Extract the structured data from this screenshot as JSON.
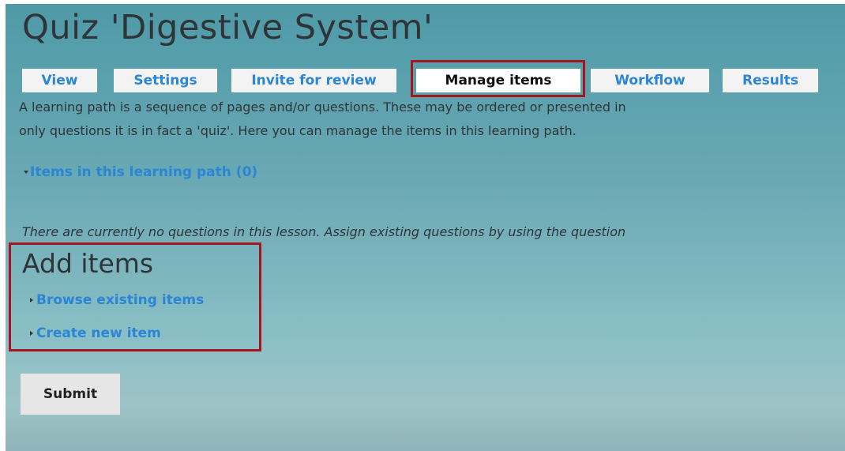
{
  "page": {
    "title": "Quiz 'Digestive System'"
  },
  "tabs": [
    {
      "label": "View",
      "active": false
    },
    {
      "label": "Settings",
      "active": false
    },
    {
      "label": "Invite for review",
      "active": false
    },
    {
      "label": "Manage items",
      "active": true
    },
    {
      "label": "Workflow",
      "active": false
    },
    {
      "label": "Results",
      "active": false
    }
  ],
  "description": {
    "line1": "A learning path is a sequence of pages and/or questions. These may be ordered or presented in",
    "line2": "only questions it is in fact a 'quiz'. Here you can manage the items in this learning path."
  },
  "items_section": {
    "toggle_label": "Items in this learning path (0)",
    "expanded": true,
    "empty_message": "There are currently no questions in this lesson. Assign existing questions by using the question"
  },
  "add_items": {
    "heading": "Add items",
    "browse_label": "Browse existing items",
    "create_label": "Create new item"
  },
  "form": {
    "submit_label": "Submit"
  },
  "colors": {
    "link": "#2a86d4",
    "highlight": "#a5151b",
    "text": "#2f3438"
  },
  "icons": {
    "expanded": "triangle-down-icon",
    "collapsed": "triangle-right-icon"
  }
}
